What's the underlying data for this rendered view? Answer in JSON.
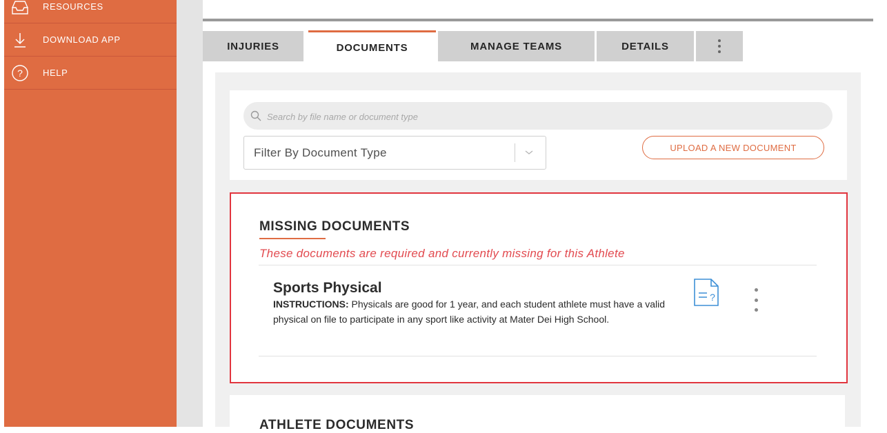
{
  "sidebar": {
    "items": [
      {
        "label": "RESOURCES",
        "icon": "inbox-icon"
      },
      {
        "label": "DOWNLOAD APP",
        "icon": "download-icon"
      },
      {
        "label": "HELP",
        "icon": "help-circle-icon"
      }
    ]
  },
  "tabs": [
    {
      "label": "INJURIES"
    },
    {
      "label": "DOCUMENTS",
      "active": true
    },
    {
      "label": "MANAGE TEAMS"
    },
    {
      "label": "DETAILS"
    }
  ],
  "search": {
    "placeholder": "Search by file name or document type"
  },
  "filter": {
    "label": "Filter By Document Type"
  },
  "upload_button": "UPLOAD A NEW DOCUMENT",
  "missing": {
    "title": "MISSING DOCUMENTS",
    "subtitle": "These documents are required and currently missing for this Athlete",
    "items": [
      {
        "title": "Sports Physical",
        "instructions_label": "INSTRUCTIONS:",
        "instructions": " Physicals are good for 1 year, and each student athlete must have a valid physical on file to participate in any sport like activity at Mater Dei High School."
      }
    ]
  },
  "athlete_documents": {
    "title": "ATHLETE DOCUMENTS"
  },
  "colors": {
    "accent": "#df6c42",
    "alert": "#e1353e",
    "doc_icon": "#3d8fd6"
  }
}
